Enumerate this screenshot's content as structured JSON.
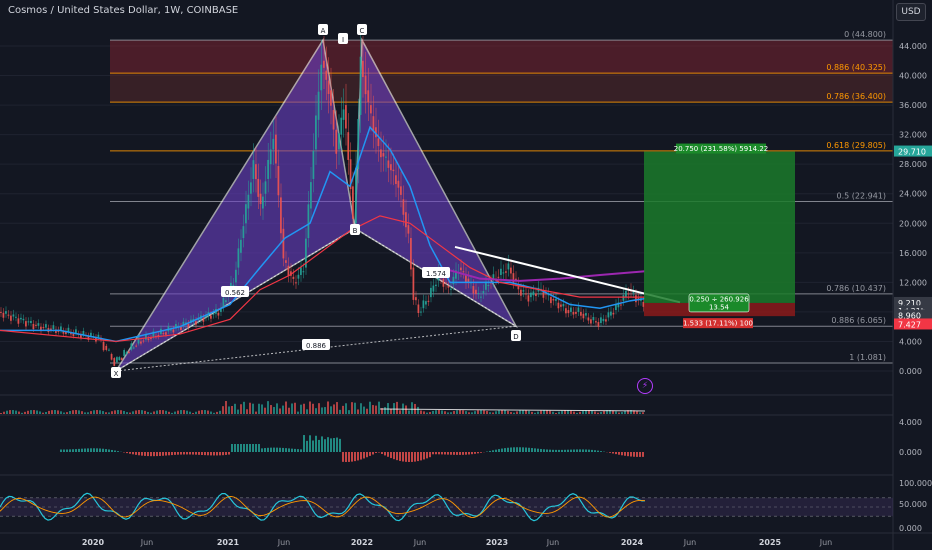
{
  "header": {
    "title": "Cosmos / United States Dollar, 1W, COINBASE",
    "currency_button": "USD"
  },
  "chart_data": {
    "type": "candlestick",
    "x_ticks": [
      "2020",
      "Jun",
      "2021",
      "Jun",
      "2022",
      "Jun",
      "2023",
      "Jun",
      "2024",
      "Jun",
      "2025",
      "Jun"
    ],
    "y_ticks": [
      "44.000",
      "40.000",
      "36.000",
      "32.000",
      "28.000",
      "24.000",
      "20.000",
      "16.000",
      "12.000",
      "8.000",
      "4.000",
      "0.000"
    ],
    "ylim": [
      0,
      46
    ],
    "price_axis_labels": [
      {
        "text": "29.710",
        "value": 29.71,
        "color": "#26a69a"
      },
      {
        "text": "9.210",
        "value": 9.21,
        "color": "#363a45"
      },
      {
        "text": "1d 21h",
        "value": 8.1,
        "color": "#363a45"
      },
      {
        "text": "8.960",
        "value": 7.5,
        "color": "#363a45"
      },
      {
        "text": "7.427",
        "value": 6.3,
        "color": "#f23645"
      }
    ],
    "fib_levels": [
      {
        "label": "0 (44.800)",
        "value": 44.8,
        "color": "#9598a1"
      },
      {
        "label": "0.886 (40.325)",
        "value": 40.325,
        "color": "#ff9800"
      },
      {
        "label": "0.786 (36.400)",
        "value": 36.4,
        "color": "#ff9800"
      },
      {
        "label": "0.618 (29.805)",
        "value": 29.805,
        "color": "#ff9800"
      },
      {
        "label": "0.5 (22.941)",
        "value": 22.941,
        "color": "#9598a1"
      },
      {
        "label": "0.786 (10.437)",
        "value": 10.437,
        "color": "#9598a1"
      },
      {
        "label": "0.886 (6.065)",
        "value": 6.065,
        "color": "#9598a1"
      },
      {
        "label": "1 (1.081)",
        "value": 1.081,
        "color": "#9598a1"
      }
    ],
    "pattern_points": [
      {
        "label": "X",
        "value": 1.081
      },
      {
        "label": "A",
        "value": 44.8
      },
      {
        "label": "I",
        "value": 44.0
      },
      {
        "label": "B",
        "value": 19.3
      },
      {
        "label": "C",
        "value": 44.8
      },
      {
        "label": "D",
        "value": 6.065
      }
    ],
    "ratios": [
      "0.562",
      "1.574",
      "0.886"
    ],
    "position": {
      "target_label": "20.750 (231.58%) 5914.22",
      "entry_label_line1": "0.250 ÷ 260.926",
      "entry_label_line2": "13.54",
      "stop_label": "1.533 (17.11%) 100",
      "target": 29.71,
      "entry": 9.21,
      "stop": 7.427
    },
    "macd_ticks": [
      "4.000",
      "0.000"
    ],
    "rsi_ticks": [
      "100.000",
      "50.000",
      "0.000"
    ]
  }
}
